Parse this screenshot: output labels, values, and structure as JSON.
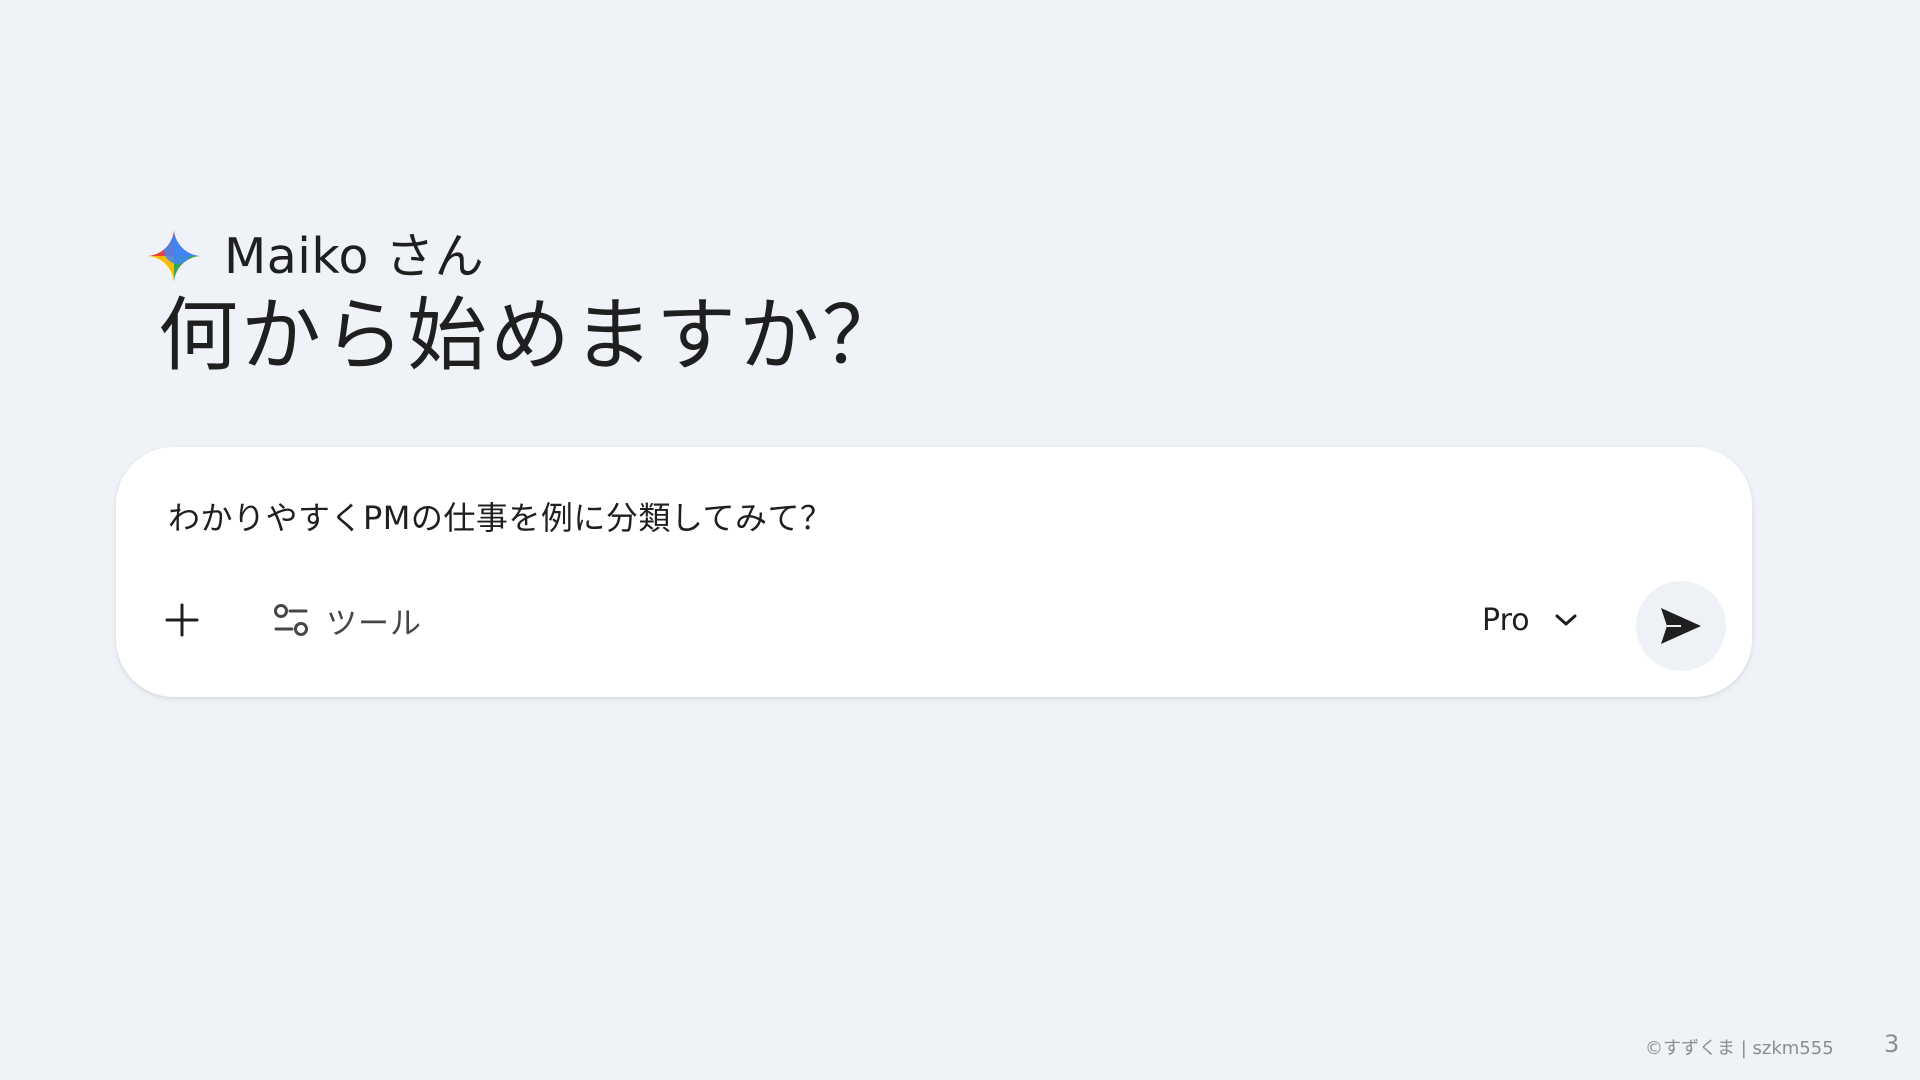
{
  "greeting": {
    "name": "Maiko さん",
    "headline": "何から始めますか？",
    "icon": "sparkle-icon"
  },
  "prompt_box": {
    "text": "わかりやすくPMの仕事を例に分類してみて？",
    "add_icon": "plus-icon",
    "tools_icon": "tune-icon",
    "tools_label": "ツール",
    "model_label": "Pro",
    "model_dropdown_icon": "chevron-down-icon",
    "send_icon": "send-icon"
  },
  "footer": {
    "credit": "©すずくま | szkm555",
    "page_number": "3"
  },
  "colors": {
    "background": "#eff3f8",
    "card": "#ffffff",
    "text_primary": "#1f1f1f",
    "text_secondary": "#444746",
    "send_button_bg": "#eef1f6",
    "sparkle_blue": "#4285f4",
    "sparkle_red": "#ea4335",
    "sparkle_yellow": "#fbbc04",
    "sparkle_green": "#34a853"
  }
}
